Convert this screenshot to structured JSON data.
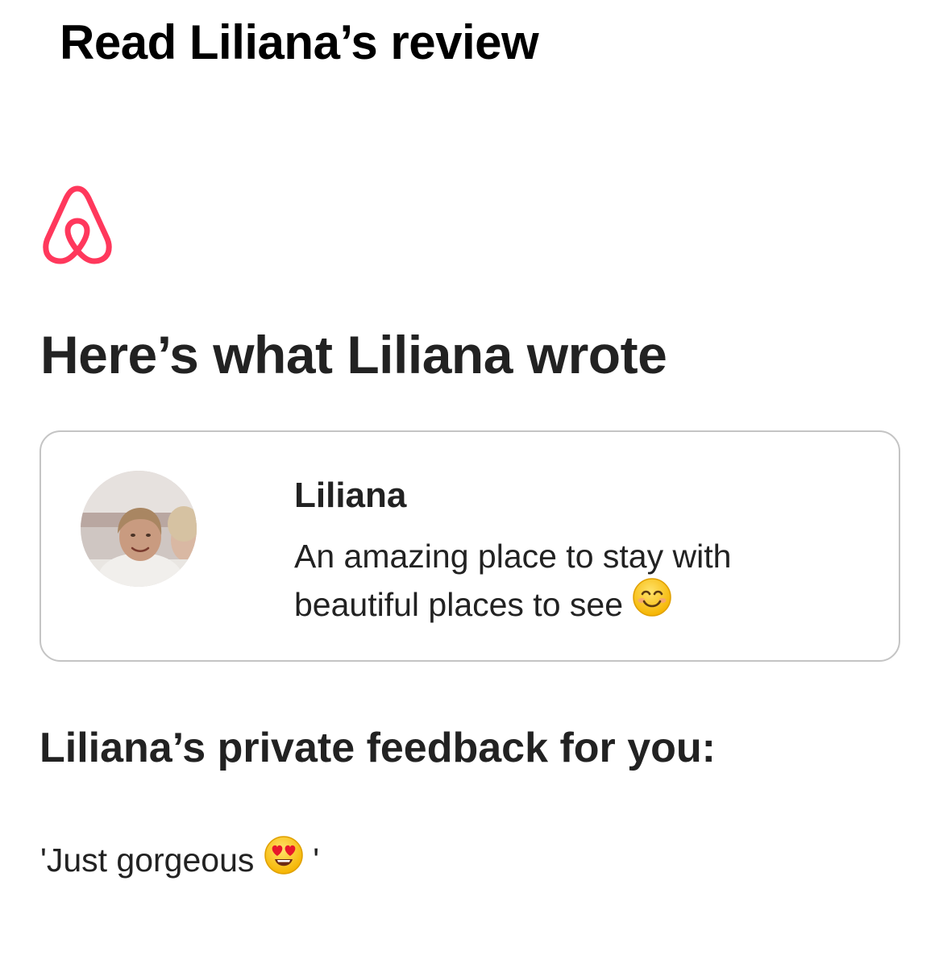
{
  "email": {
    "subject": "Read Liliana’s review"
  },
  "brand": {
    "logo_icon": "airbnb-belo-icon",
    "accent_color": "#FF385C"
  },
  "main": {
    "heading": "Here’s what Liliana wrote",
    "review": {
      "reviewer_name": "Liliana",
      "text": "An amazing place to stay with beautiful places to see",
      "emoji_icon": "smiling-face-emoji",
      "avatar_icon": "reviewer-avatar-photo"
    },
    "private_feedback": {
      "heading": "Liliana’s private feedback for you:",
      "quote_open": "'Just gorgeous",
      "emoji_icon": "heart-eyes-emoji",
      "quote_close": "'"
    }
  }
}
